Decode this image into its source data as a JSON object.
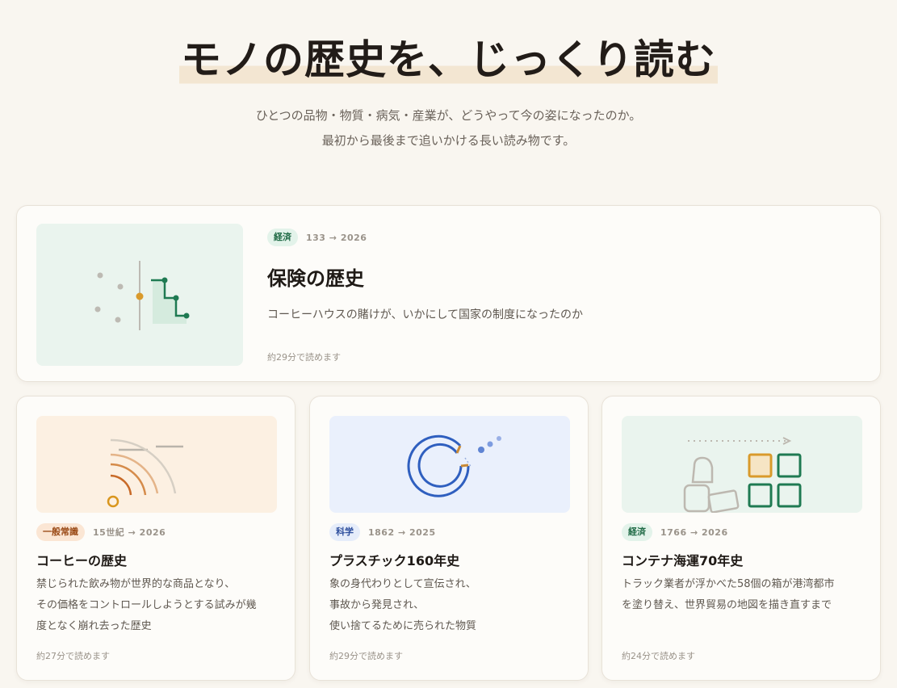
{
  "hero": {
    "title": "モノの歴史を、じっくり読む",
    "subtitle_line1": "ひとつの品物・物質・病気・産業が、どうやって今の姿になったのか。",
    "subtitle_line2": "最初から最後まで追いかける長い読み物です。"
  },
  "featured": {
    "tag": "経済",
    "years": "133 → 2026",
    "title": "保険の歴史",
    "description": "コーヒーハウスの賭けが、いかにして国家の制度になったのか",
    "read_time": "約29分で読めます",
    "thumb_icon": "insurance-illustration-icon"
  },
  "cards": [
    {
      "tag": "一般常識",
      "years": "15世紀 → 2026",
      "title": "コーヒーの歴史",
      "desc_lines": [
        "禁じられた飲み物が世界的な商品となり、",
        "その価格をコントロールしようとする試みが幾",
        "度となく崩れ去った歴史"
      ],
      "read_time": "約27分で読めます",
      "thumb_icon": "coffee-aroma-illustration-icon"
    },
    {
      "tag": "科学",
      "years": "1862 → 2025",
      "title": "プラスチック160年史",
      "desc_lines": [
        "象の身代わりとして宣伝され、",
        "事故から発見され、",
        "使い捨てるために売られた物質"
      ],
      "read_time": "約29分で読めます",
      "thumb_icon": "plastic-ring-illustration-icon"
    },
    {
      "tag": "経済",
      "years": "1766 → 2026",
      "title": "コンテナ海運70年史",
      "desc_lines": [
        "トラック業者が浮かべた58個の箱が港湾都市",
        "を塗り替え、世界貿易の地図を描き直すまで"
      ],
      "read_time": "約24分で読めます",
      "thumb_icon": "container-shipping-illustration-icon"
    }
  ],
  "colors": {
    "background": "#f9f6f0",
    "econ_tag_bg": "#e3f3ea",
    "sci_tag_bg": "#e6edfa",
    "general_tag_bg": "#fbe6d4",
    "accent_green": "#1f7a52",
    "accent_orange": "#d98a3a",
    "accent_blue": "#2f5fbf"
  }
}
